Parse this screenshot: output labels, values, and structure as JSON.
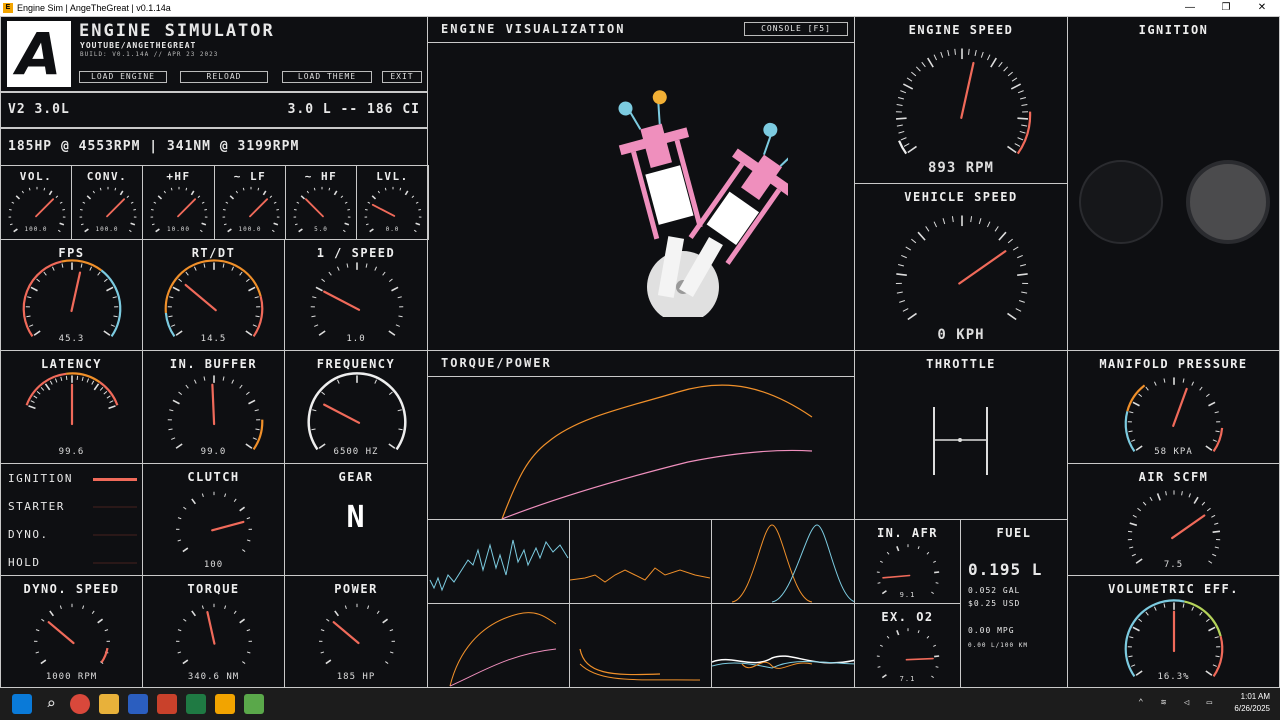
{
  "window": {
    "title": "Engine Sim | AngeTheGreat | v0.1.14a",
    "minimize": "—",
    "maximize": "❐",
    "close": "✕"
  },
  "header": {
    "logo": "A",
    "app_name": "ENGINE SIMULATOR",
    "channel": "YOUTUBE/ANGETHEGREAT",
    "build": "BUILD: V0.1.14A // APR 23 2023",
    "buttons": [
      "LOAD ENGINE",
      "RELOAD",
      "LOAD THEME",
      "EXIT"
    ]
  },
  "engine": {
    "name": "V2 3.0L",
    "displacement": "3.0 L -- 186 CI",
    "power_summary": "185HP @ 4553RPM | 341NM @ 3199RPM"
  },
  "mix_gauges": [
    {
      "label": "VOL.",
      "value": "100.0"
    },
    {
      "label": "CONV.",
      "value": "100.0"
    },
    {
      "label": "+HF",
      "value": "10.00"
    },
    {
      "label": "~ LF",
      "value": "100.0"
    },
    {
      "label": "~ HF",
      "value": "5.0"
    },
    {
      "label": "LVL.",
      "value": "0.0"
    }
  ],
  "perf": {
    "fps": {
      "label": "FPS",
      "value": "45.3"
    },
    "rtdt": {
      "label": "RT/DT",
      "value": "14.5"
    },
    "speed": {
      "label": "1 / SPEED",
      "value": "1.0"
    }
  },
  "audio": {
    "latency": {
      "label": "LATENCY",
      "value": "99.6"
    },
    "buffer": {
      "label": "IN. BUFFER",
      "value": "99.0"
    },
    "frequency": {
      "label": "FREQUENCY",
      "value": "6500 HZ"
    }
  },
  "switches": {
    "ignition": "IGNITION",
    "starter": "STARTER",
    "dyno": "DYNO.",
    "hold": "HOLD"
  },
  "clutch": {
    "label": "CLUTCH",
    "value": "100"
  },
  "gear": {
    "label": "GEAR",
    "value": "N"
  },
  "dyno": {
    "speed": {
      "label": "DYNO. SPEED",
      "value": "1000 RPM"
    },
    "torque": {
      "label": "TORQUE",
      "value": "340.6 NM"
    },
    "power": {
      "label": "POWER",
      "value": "185 HP"
    }
  },
  "viz": {
    "title": "ENGINE VISUALIZATION",
    "console": "CONSOLE [F5]"
  },
  "torque_power": {
    "title": "TORQUE/POWER"
  },
  "engine_speed": {
    "label": "ENGINE SPEED",
    "value": "893 RPM"
  },
  "vehicle_speed": {
    "label": "VEHICLE SPEED",
    "value": "0 KPH"
  },
  "throttle": {
    "label": "THROTTLE"
  },
  "ignition_panel": {
    "label": "IGNITION"
  },
  "manifold": {
    "label": "MANIFOLD PRESSURE",
    "value": "58 KPA"
  },
  "air": {
    "label": "AIR SCFM",
    "value": "7.5"
  },
  "vol_eff": {
    "label": "VOLUMETRIC EFF.",
    "value": "16.3%"
  },
  "afr": {
    "in_label": "IN. AFR",
    "in_value": "9.1",
    "ex_label": "EX. O2",
    "ex_value": "7.1"
  },
  "fuel": {
    "label": "FUEL",
    "liters": "0.195 L",
    "gal": "0.052 GAL",
    "usd": "$0.25 USD",
    "mpg": "0.00 MPG",
    "lkm": "0.00 L/100 KM"
  },
  "colors": {
    "accent": "#f06a5a",
    "orange": "#f0902a",
    "blue": "#7ccbe0",
    "pink": "#ef8fbd",
    "panel_bg": "#0e0f12",
    "border": "#c9c9c9"
  },
  "clock": {
    "time": "1:01 AM",
    "date": "6/26/2025"
  }
}
